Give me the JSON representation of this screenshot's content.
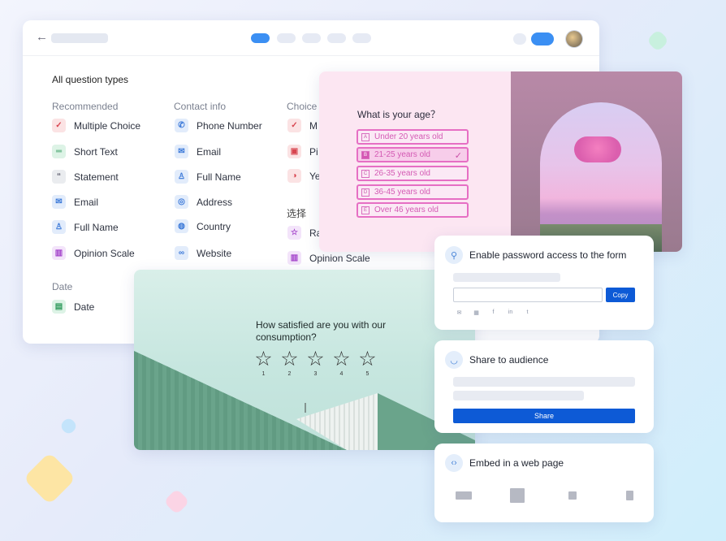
{
  "colors": {
    "accent": "#0d5ad6",
    "toggle": "#3b8ff3",
    "pink": "#e66fc4"
  },
  "main": {
    "heading": "All question types",
    "columns": [
      {
        "title": "Recommended",
        "items": [
          {
            "label": "Multiple Choice",
            "icon": "check-icon"
          },
          {
            "label": "Short Text",
            "icon": "short-text-icon"
          },
          {
            "label": "Statement",
            "icon": "quote-icon"
          },
          {
            "label": "Email",
            "icon": "mail-icon"
          },
          {
            "label": "Full Name",
            "icon": "person-icon"
          },
          {
            "label": "Opinion Scale",
            "icon": "bar-chart-icon"
          }
        ]
      },
      {
        "title": "Contact info",
        "items": [
          {
            "label": "Phone Number",
            "icon": "phone-icon"
          },
          {
            "label": "Email",
            "icon": "mail-icon"
          },
          {
            "label": "Full Name",
            "icon": "person-icon"
          },
          {
            "label": "Address",
            "icon": "location-pin-icon"
          },
          {
            "label": "Country",
            "icon": "globe-icon"
          },
          {
            "label": "Website",
            "icon": "link-icon"
          }
        ]
      },
      {
        "title": "Choice",
        "items": [
          {
            "label": "M",
            "icon": "check-icon"
          },
          {
            "label": "Pi",
            "icon": "image-icon"
          },
          {
            "label": "Ye",
            "icon": "yes-no-icon"
          }
        ]
      },
      {
        "title": "选择",
        "items": [
          {
            "label": "Ra",
            "icon": "star-icon"
          },
          {
            "label": "Opinion Scale",
            "icon": "bar-chart-icon"
          }
        ]
      },
      {
        "title": "Date",
        "items": [
          {
            "label": "Date",
            "icon": "calendar-icon"
          }
        ]
      }
    ]
  },
  "age_form": {
    "question": "What is your age？",
    "options": [
      {
        "key": "A",
        "label": "Under 20 years old",
        "selected": false
      },
      {
        "key": "B",
        "label": "21-25 years old",
        "selected": true
      },
      {
        "key": "C",
        "label": "26-35 years old",
        "selected": false
      },
      {
        "key": "D",
        "label": "36-45 years old",
        "selected": false
      },
      {
        "key": "E",
        "label": "Over 46 years old",
        "selected": false
      }
    ]
  },
  "satisfaction": {
    "question_line1": "How satisfied are you with our",
    "question_line2": "consumption?",
    "ratings": [
      "1",
      "2",
      "3",
      "4",
      "5"
    ]
  },
  "password_card": {
    "title": "Enable password access to the form",
    "copy_label": "Copy",
    "social_icons": [
      "mail-icon",
      "qr-code-icon",
      "facebook-icon",
      "linkedin-icon",
      "twitter-icon"
    ]
  },
  "share_card": {
    "title": "Share to audience",
    "share_label": "Share"
  },
  "embed_card": {
    "title": "Embed in a web page",
    "options": [
      "embed-standard-icon",
      "embed-full-page-icon",
      "embed-popup-icon",
      "embed-side-panel-icon"
    ]
  }
}
